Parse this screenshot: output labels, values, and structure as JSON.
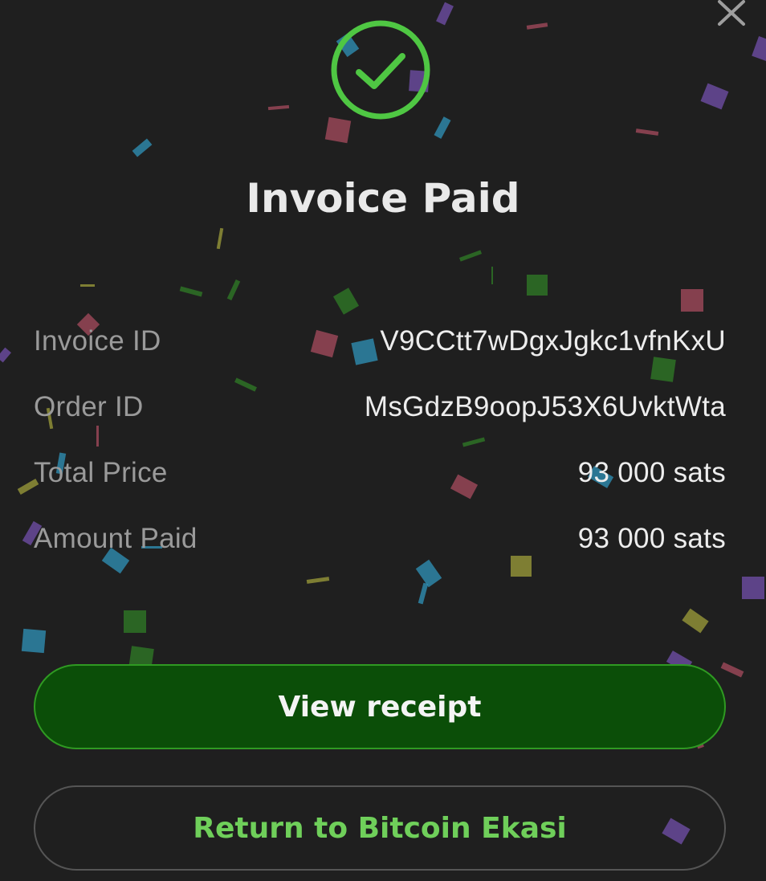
{
  "modal": {
    "title": "Invoice Paid",
    "status_icon": "check-circle-icon",
    "close_icon": "close-icon"
  },
  "details": [
    {
      "label": "Invoice ID",
      "value": "V9CCtt7wDgxJgkc1vfnKxU"
    },
    {
      "label": "Order ID",
      "value": "MsGdzB9oopJ53X6UvktWta"
    },
    {
      "label": "Total Price",
      "value": "93 000 sats"
    },
    {
      "label": "Amount Paid",
      "value": "93 000 sats"
    }
  ],
  "actions": {
    "view_receipt_label": "View receipt",
    "return_label": "Return to Bitcoin Ekasi"
  },
  "colors": {
    "background": "#1f1f1f",
    "success_green": "#4fc743",
    "primary_button_bg": "#0b4e08",
    "primary_button_border": "#2f9a22",
    "secondary_button_text": "#6fcf5a",
    "confetti": [
      "#6f4ea6",
      "#2f8fb5",
      "#a34a5c",
      "#2f7a26",
      "#9a9a3a"
    ]
  }
}
